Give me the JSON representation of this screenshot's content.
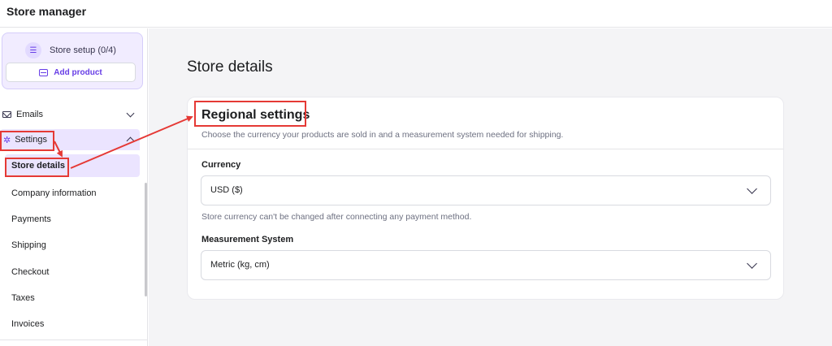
{
  "app": {
    "title": "Store manager"
  },
  "sidebar": {
    "setup": {
      "label": "Store setup (0/4)",
      "icon": "list-icon"
    },
    "add_product": {
      "label": "Add product",
      "icon": "box-icon"
    },
    "items": [
      {
        "label": "Emails",
        "icon": "mail-icon",
        "expanded": false
      },
      {
        "label": "Settings",
        "icon": "gear-icon",
        "expanded": true
      },
      {
        "label": "Store details",
        "selected": true
      },
      {
        "label": "Company information"
      },
      {
        "label": "Payments"
      },
      {
        "label": "Shipping"
      },
      {
        "label": "Checkout"
      },
      {
        "label": "Taxes"
      },
      {
        "label": "Invoices"
      }
    ]
  },
  "main": {
    "page_title": "Store details",
    "regional": {
      "title": "Regional settings",
      "description": "Choose the currency your products are sold in and a measurement system needed for shipping.",
      "currency": {
        "label": "Currency",
        "value": "USD ($)",
        "hint": "Store currency can't be changed after connecting any payment method."
      },
      "measurement": {
        "label": "Measurement System",
        "value": "Metric (kg, cm)"
      }
    }
  },
  "colors": {
    "accent": "#673de6",
    "accent_light": "#ebe4ff",
    "annotation": "#e53935",
    "page_bg": "#f4f4f6"
  }
}
